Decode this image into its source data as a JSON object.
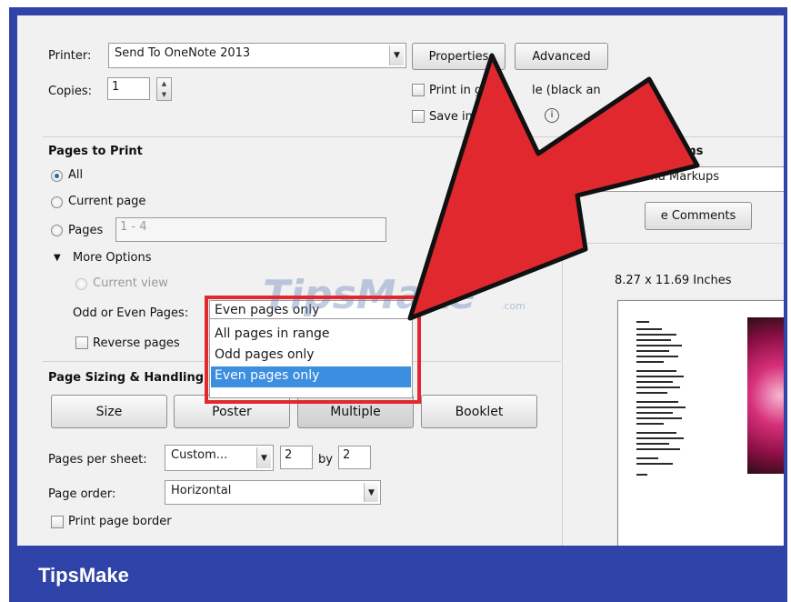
{
  "printer": {
    "label": "Printer:",
    "value": "Send To OneNote 2013",
    "properties_button": "Properties",
    "advanced_button": "Advanced"
  },
  "copies": {
    "label": "Copies:",
    "value": "1"
  },
  "options": {
    "grayscale_label": "Print in gr",
    "grayscale_label_tail": "le (black an",
    "save_ink_label": "Save ink"
  },
  "pages_to_print": {
    "heading": "Pages to Print",
    "all_label": "All",
    "current_page_label": "Current page",
    "pages_label": "Pages",
    "pages_value": "1 - 4",
    "more_options_label": "More Options",
    "current_view_label": "Current view",
    "odd_even_label": "Odd or Even Pages:",
    "odd_even_value": "Even pages only",
    "odd_even_options": [
      "All pages in range",
      "Odd pages only",
      "Even pages only"
    ],
    "reverse_pages_label": "Reverse pages"
  },
  "page_sizing": {
    "heading": "Page Sizing & Handling",
    "size_button": "Size",
    "poster_button": "Poster",
    "multiple_button": "Multiple",
    "booklet_button": "Booklet",
    "pages_per_sheet_label": "Pages per sheet:",
    "pages_per_sheet_value": "Custom...",
    "cols_value": "2",
    "by_label": "by",
    "rows_value": "2",
    "page_order_label": "Page order:",
    "page_order_value": "Horizontal",
    "print_border_label": "Print page border"
  },
  "comments_forms": {
    "heading": "ents & Forms",
    "value": "ocument and Markups",
    "button": "e Comments"
  },
  "preview": {
    "size_label": "8.27 x 11.69 Inches"
  },
  "watermark": {
    "text": "TipsMake",
    "suffix": ".com"
  },
  "footer": {
    "brand": "TipsMake"
  },
  "colors": {
    "frame": "#2f43a8",
    "arrow": "#e2282f",
    "selection": "#3c8ee0"
  }
}
